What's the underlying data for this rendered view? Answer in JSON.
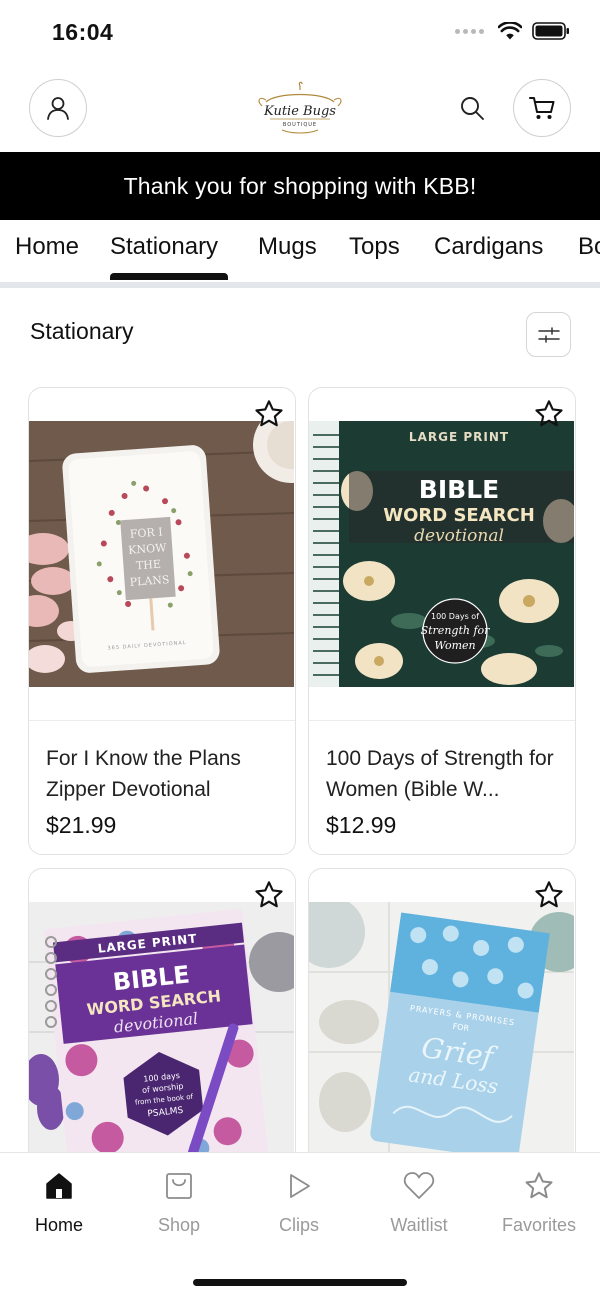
{
  "status_bar": {
    "time": "16:04"
  },
  "header": {
    "logo_text": "Kutie Bugs",
    "logo_sub": "BOUTIQUE"
  },
  "banner": {
    "text": "Thank you for shopping with KBB!"
  },
  "tabs": [
    {
      "label": "Home",
      "active": false
    },
    {
      "label": "Stationary",
      "active": true
    },
    {
      "label": "Mugs",
      "active": false
    },
    {
      "label": "Tops",
      "active": false
    },
    {
      "label": "Cardigans",
      "active": false
    },
    {
      "label": "Bo",
      "active": false
    }
  ],
  "section": {
    "title": "Stationary"
  },
  "products": [
    {
      "name": "For I Know the Plans Zipper Devotional",
      "price": "$21.99",
      "cover_text": [
        "FOR I",
        "KNOW",
        "THE",
        "PLANS"
      ],
      "cover_footer": "365 DAILY DEVOTIONAL"
    },
    {
      "name": "100 Days of Strength for Women (Bible W...",
      "price": "$12.99",
      "cover_lines": [
        "LARGE PRINT",
        "BIBLE",
        "WORD SEARCH",
        "devotional"
      ],
      "badge": [
        "100 Days of",
        "Strength for",
        "Women"
      ]
    },
    {
      "name": "",
      "price": "",
      "cover_lines": [
        "LARGE PRINT",
        "BIBLE",
        "WORD SEARCH",
        "devotional"
      ],
      "badge": [
        "100 days",
        "of worship",
        "from the book of",
        "PSALMS"
      ]
    },
    {
      "name": "",
      "price": "",
      "cover_lines": [
        "PRAYERS & PROMISES",
        "FOR",
        "Grief",
        "and Loss"
      ]
    }
  ],
  "bottom_nav": [
    {
      "label": "Home",
      "icon": "home-icon",
      "active": true
    },
    {
      "label": "Shop",
      "icon": "shopping-bag-icon",
      "active": false
    },
    {
      "label": "Clips",
      "icon": "play-icon",
      "active": false
    },
    {
      "label": "Waitlist",
      "icon": "heart-icon",
      "active": false
    },
    {
      "label": "Favorites",
      "icon": "star-icon",
      "active": false
    }
  ],
  "colors": {
    "banner_bg": "#000000",
    "accent": "#111111",
    "inactive": "#9a9a9a"
  }
}
